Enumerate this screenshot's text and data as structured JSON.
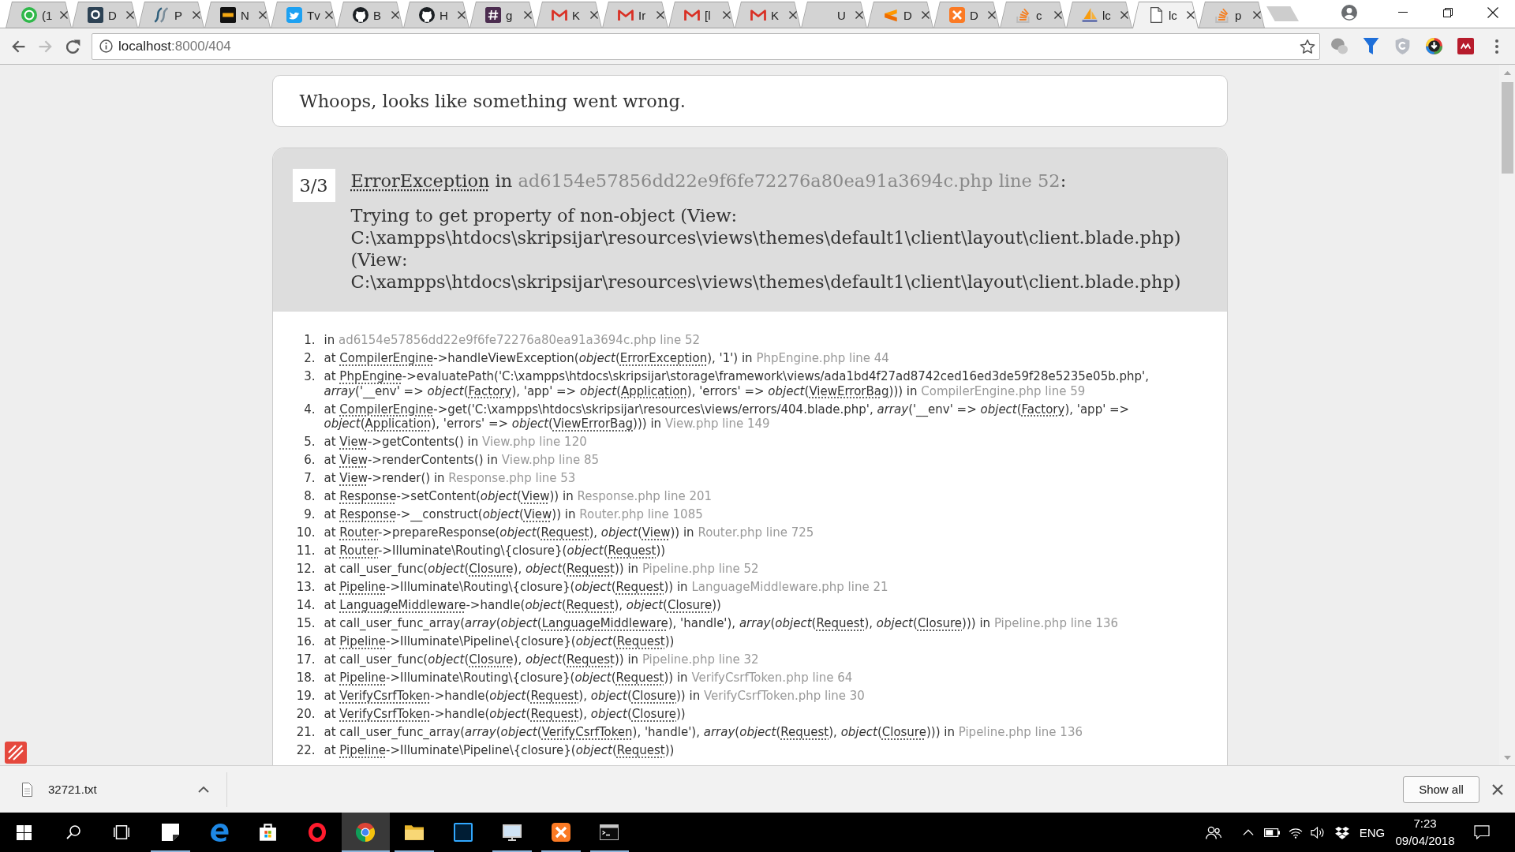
{
  "browser": {
    "tabs": [
      {
        "title": "(1",
        "selected": false
      },
      {
        "title": "D",
        "selected": false
      },
      {
        "title": "P",
        "selected": false
      },
      {
        "title": "N",
        "selected": false
      },
      {
        "title": "Tv",
        "selected": false
      },
      {
        "title": "B",
        "selected": false
      },
      {
        "title": "H",
        "selected": false
      },
      {
        "title": "g",
        "selected": false
      },
      {
        "title": "K",
        "selected": false
      },
      {
        "title": "Ir",
        "selected": false
      },
      {
        "title": "[l",
        "selected": false
      },
      {
        "title": "K",
        "selected": false
      },
      {
        "title": "U",
        "selected": false
      },
      {
        "title": "D",
        "selected": false
      },
      {
        "title": "D",
        "selected": false
      },
      {
        "title": "c",
        "selected": false
      },
      {
        "title": "lc",
        "selected": false
      },
      {
        "title": "lc",
        "selected": true
      },
      {
        "title": "p",
        "selected": false
      }
    ],
    "back_button": {
      "disabled": false
    },
    "forward_button": {
      "disabled": true
    },
    "address_bar": {
      "host": "localhost",
      "path": ":8000/404"
    }
  },
  "page": {
    "heading": "Whoops, looks like something went wrong.",
    "exception": {
      "counter": "3/3",
      "title": [
        {
          "kind": "class",
          "text": "ErrorException"
        },
        {
          "kind": "text",
          "text": " in "
        },
        {
          "kind": "file",
          "text": "ad6154e57856dd22e9f6fe72276a80ea91a3694c.php line 52"
        },
        {
          "kind": "text",
          "text": ":"
        }
      ],
      "message": "Trying to get property of non-object (View: C:\\xampps\\htdocs\\skripsijar\\resources\\views\\themes\\default1\\client\\layout\\client.blade.php) (View: C:\\xampps\\htdocs\\skripsijar\\resources\\views\\themes\\default1\\client\\layout\\client.blade.php)"
    },
    "trace": [
      {
        "number": "1.",
        "parts": [
          {
            "kind": "text",
            "text": "in "
          },
          {
            "kind": "file",
            "text": "ad6154e57856dd22e9f6fe72276a80ea91a3694c.php line 52"
          }
        ]
      },
      {
        "number": "2.",
        "parts": [
          {
            "kind": "text",
            "text": "at "
          },
          {
            "kind": "class",
            "text": "CompilerEngine"
          },
          {
            "kind": "text",
            "text": "->handleViewException(*object*("
          },
          {
            "kind": "class",
            "text": "ErrorException"
          },
          {
            "kind": "text",
            "text": "), '1') in "
          },
          {
            "kind": "file",
            "text": "PhpEngine.php line 44"
          }
        ]
      },
      {
        "number": "3.",
        "parts": [
          {
            "kind": "text",
            "text": "at "
          },
          {
            "kind": "class",
            "text": "PhpEngine"
          },
          {
            "kind": "text",
            "text": "->evaluatePath('C:\\xampps\\htdocs\\skripsijar\\storage\\framework\\views/ada1bd4f27ad8742ced16ed3de59f28e5235e05b.php', *array*('__env' => *object*("
          },
          {
            "kind": "class",
            "text": "Factory"
          },
          {
            "kind": "text",
            "text": "), 'app' => *object*("
          },
          {
            "kind": "class",
            "text": "Application"
          },
          {
            "kind": "text",
            "text": "), 'errors' => *object*("
          },
          {
            "kind": "class",
            "text": "ViewErrorBag"
          },
          {
            "kind": "text",
            "text": "))) in "
          },
          {
            "kind": "file",
            "text": "CompilerEngine.php line 59"
          }
        ]
      },
      {
        "number": "4.",
        "parts": [
          {
            "kind": "text",
            "text": "at "
          },
          {
            "kind": "class",
            "text": "CompilerEngine"
          },
          {
            "kind": "text",
            "text": "->get('C:\\xampps\\htdocs\\skripsijar\\resources\\views/errors/404.blade.php', *array*('__env' => *object*("
          },
          {
            "kind": "class",
            "text": "Factory"
          },
          {
            "kind": "text",
            "text": "), 'app' => *object*("
          },
          {
            "kind": "class",
            "text": "Application"
          },
          {
            "kind": "text",
            "text": "), 'errors' => *object*("
          },
          {
            "kind": "class",
            "text": "ViewErrorBag"
          },
          {
            "kind": "text",
            "text": "))) in "
          },
          {
            "kind": "file",
            "text": "View.php line 149"
          }
        ]
      },
      {
        "number": "5.",
        "parts": [
          {
            "kind": "text",
            "text": "at "
          },
          {
            "kind": "class",
            "text": "View"
          },
          {
            "kind": "text",
            "text": "->getContents() in "
          },
          {
            "kind": "file",
            "text": "View.php line 120"
          }
        ]
      },
      {
        "number": "6.",
        "parts": [
          {
            "kind": "text",
            "text": "at "
          },
          {
            "kind": "class",
            "text": "View"
          },
          {
            "kind": "text",
            "text": "->renderContents() in "
          },
          {
            "kind": "file",
            "text": "View.php line 85"
          }
        ]
      },
      {
        "number": "7.",
        "parts": [
          {
            "kind": "text",
            "text": "at "
          },
          {
            "kind": "class",
            "text": "View"
          },
          {
            "kind": "text",
            "text": "->render() in "
          },
          {
            "kind": "file",
            "text": "Response.php line 53"
          }
        ]
      },
      {
        "number": "8.",
        "parts": [
          {
            "kind": "text",
            "text": "at "
          },
          {
            "kind": "class",
            "text": "Response"
          },
          {
            "kind": "text",
            "text": "->setContent(*object*("
          },
          {
            "kind": "class",
            "text": "View"
          },
          {
            "kind": "text",
            "text": ")) in "
          },
          {
            "kind": "file",
            "text": "Response.php line 201"
          }
        ]
      },
      {
        "number": "9.",
        "parts": [
          {
            "kind": "text",
            "text": "at "
          },
          {
            "kind": "class",
            "text": "Response"
          },
          {
            "kind": "text",
            "text": "->__construct(*object*("
          },
          {
            "kind": "class",
            "text": "View"
          },
          {
            "kind": "text",
            "text": ")) in "
          },
          {
            "kind": "file",
            "text": "Router.php line 1085"
          }
        ]
      },
      {
        "number": "10.",
        "parts": [
          {
            "kind": "text",
            "text": "at "
          },
          {
            "kind": "class",
            "text": "Router"
          },
          {
            "kind": "text",
            "text": "->prepareResponse(*object*("
          },
          {
            "kind": "class",
            "text": "Request"
          },
          {
            "kind": "text",
            "text": "), *object*("
          },
          {
            "kind": "class",
            "text": "View"
          },
          {
            "kind": "text",
            "text": ")) in "
          },
          {
            "kind": "file",
            "text": "Router.php line 725"
          }
        ]
      },
      {
        "number": "11.",
        "parts": [
          {
            "kind": "text",
            "text": "at "
          },
          {
            "kind": "class",
            "text": "Router"
          },
          {
            "kind": "text",
            "text": "->Illuminate\\Routing\\{closure}(*object*("
          },
          {
            "kind": "class",
            "text": "Request"
          },
          {
            "kind": "text",
            "text": "))"
          }
        ]
      },
      {
        "number": "12.",
        "parts": [
          {
            "kind": "text",
            "text": "at call_user_func(*object*("
          },
          {
            "kind": "class",
            "text": "Closure"
          },
          {
            "kind": "text",
            "text": "), *object*("
          },
          {
            "kind": "class",
            "text": "Request"
          },
          {
            "kind": "text",
            "text": ")) in "
          },
          {
            "kind": "file",
            "text": "Pipeline.php line 52"
          }
        ]
      },
      {
        "number": "13.",
        "parts": [
          {
            "kind": "text",
            "text": "at "
          },
          {
            "kind": "class",
            "text": "Pipeline"
          },
          {
            "kind": "text",
            "text": "->Illuminate\\Routing\\{closure}(*object*("
          },
          {
            "kind": "class",
            "text": "Request"
          },
          {
            "kind": "text",
            "text": ")) in "
          },
          {
            "kind": "file",
            "text": "LanguageMiddleware.php line 21"
          }
        ]
      },
      {
        "number": "14.",
        "parts": [
          {
            "kind": "text",
            "text": "at "
          },
          {
            "kind": "class",
            "text": "LanguageMiddleware"
          },
          {
            "kind": "text",
            "text": "->handle(*object*("
          },
          {
            "kind": "class",
            "text": "Request"
          },
          {
            "kind": "text",
            "text": "), *object*("
          },
          {
            "kind": "class",
            "text": "Closure"
          },
          {
            "kind": "text",
            "text": "))"
          }
        ]
      },
      {
        "number": "15.",
        "parts": [
          {
            "kind": "text",
            "text": "at call_user_func_array(*array*(*object*("
          },
          {
            "kind": "class",
            "text": "LanguageMiddleware"
          },
          {
            "kind": "text",
            "text": "), 'handle'), *array*(*object*("
          },
          {
            "kind": "class",
            "text": "Request"
          },
          {
            "kind": "text",
            "text": "), *object*("
          },
          {
            "kind": "class",
            "text": "Closure"
          },
          {
            "kind": "text",
            "text": "))) in "
          },
          {
            "kind": "file",
            "text": "Pipeline.php line 136"
          }
        ]
      },
      {
        "number": "16.",
        "parts": [
          {
            "kind": "text",
            "text": "at "
          },
          {
            "kind": "class",
            "text": "Pipeline"
          },
          {
            "kind": "text",
            "text": "->Illuminate\\Pipeline\\{closure}(*object*("
          },
          {
            "kind": "class",
            "text": "Request"
          },
          {
            "kind": "text",
            "text": "))"
          }
        ]
      },
      {
        "number": "17.",
        "parts": [
          {
            "kind": "text",
            "text": "at call_user_func(*object*("
          },
          {
            "kind": "class",
            "text": "Closure"
          },
          {
            "kind": "text",
            "text": "), *object*("
          },
          {
            "kind": "class",
            "text": "Request"
          },
          {
            "kind": "text",
            "text": ")) in "
          },
          {
            "kind": "file",
            "text": "Pipeline.php line 32"
          }
        ]
      },
      {
        "number": "18.",
        "parts": [
          {
            "kind": "text",
            "text": "at "
          },
          {
            "kind": "class",
            "text": "Pipeline"
          },
          {
            "kind": "text",
            "text": "->Illuminate\\Routing\\{closure}(*object*("
          },
          {
            "kind": "class",
            "text": "Request"
          },
          {
            "kind": "text",
            "text": ")) in "
          },
          {
            "kind": "file",
            "text": "VerifyCsrfToken.php line 64"
          }
        ]
      },
      {
        "number": "19.",
        "parts": [
          {
            "kind": "text",
            "text": "at "
          },
          {
            "kind": "class",
            "text": "VerifyCsrfToken"
          },
          {
            "kind": "text",
            "text": "->handle(*object*("
          },
          {
            "kind": "class",
            "text": "Request"
          },
          {
            "kind": "text",
            "text": "), *object*("
          },
          {
            "kind": "class",
            "text": "Closure"
          },
          {
            "kind": "text",
            "text": ")) in "
          },
          {
            "kind": "file",
            "text": "VerifyCsrfToken.php line 30"
          }
        ]
      },
      {
        "number": "20.",
        "parts": [
          {
            "kind": "text",
            "text": "at "
          },
          {
            "kind": "class",
            "text": "VerifyCsrfToken"
          },
          {
            "kind": "text",
            "text": "->handle(*object*("
          },
          {
            "kind": "class",
            "text": "Request"
          },
          {
            "kind": "text",
            "text": "), *object*("
          },
          {
            "kind": "class",
            "text": "Closure"
          },
          {
            "kind": "text",
            "text": "))"
          }
        ]
      },
      {
        "number": "21.",
        "parts": [
          {
            "kind": "text",
            "text": "at call_user_func_array(*array*(*object*("
          },
          {
            "kind": "class",
            "text": "VerifyCsrfToken"
          },
          {
            "kind": "text",
            "text": "), 'handle'), *array*(*object*("
          },
          {
            "kind": "class",
            "text": "Request"
          },
          {
            "kind": "text",
            "text": "), *object*("
          },
          {
            "kind": "class",
            "text": "Closure"
          },
          {
            "kind": "text",
            "text": "))) in "
          },
          {
            "kind": "file",
            "text": "Pipeline.php line 136"
          }
        ]
      },
      {
        "number": "22.",
        "parts": [
          {
            "kind": "text",
            "text": "at "
          },
          {
            "kind": "class",
            "text": "Pipeline"
          },
          {
            "kind": "text",
            "text": "->Illuminate\\Pipeline\\{closure}(*object*("
          },
          {
            "kind": "class",
            "text": "Request"
          },
          {
            "kind": "text",
            "text": "))"
          }
        ]
      }
    ]
  },
  "downloads": {
    "items": [
      {
        "file_name": "32721.txt"
      }
    ],
    "show_all": "Show all"
  },
  "taskbar": {
    "apps": [
      {
        "running": true,
        "selected": false
      },
      {
        "running": false,
        "selected": false
      },
      {
        "running": false,
        "selected": false
      },
      {
        "running": false,
        "selected": false
      },
      {
        "running": true,
        "selected": true
      },
      {
        "running": true,
        "selected": false
      },
      {
        "running": false,
        "selected": false
      },
      {
        "running": true,
        "selected": false
      },
      {
        "running": true,
        "selected": false
      },
      {
        "running": true,
        "selected": false
      }
    ],
    "language": "ENG",
    "time": "7:23",
    "date": "09/04/2018"
  }
}
